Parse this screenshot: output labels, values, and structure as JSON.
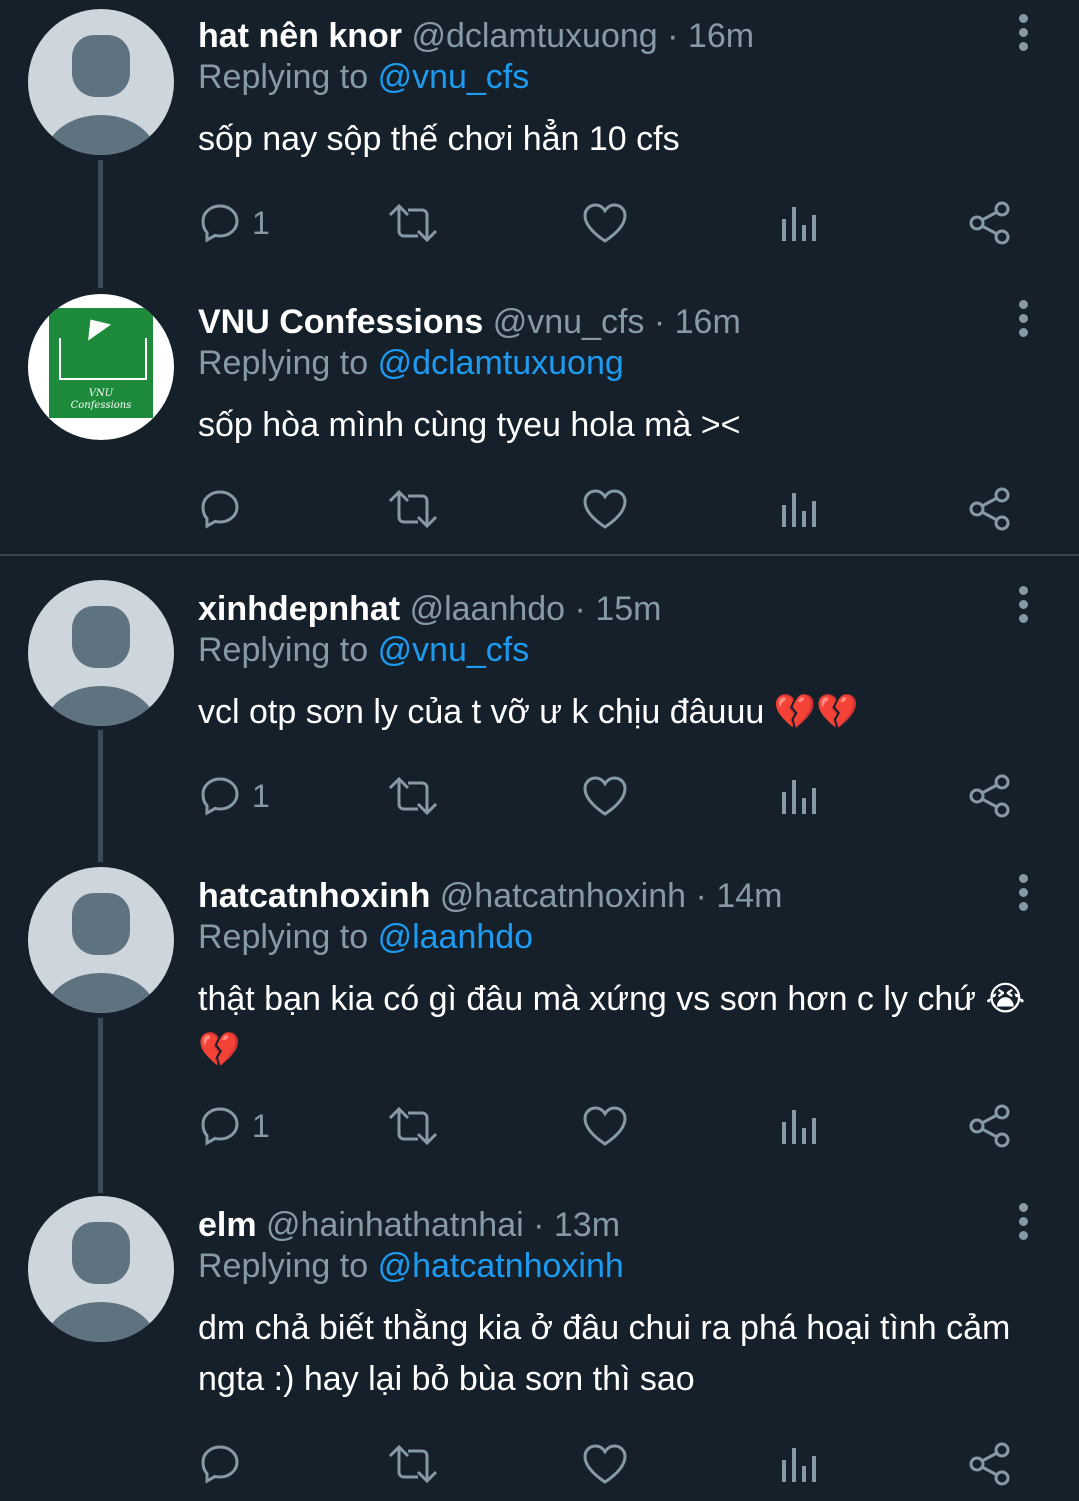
{
  "tweets": [
    {
      "name": "hat nên knor",
      "handle": "@dclamtuxuong",
      "time": "· 16m",
      "replying_label": "Replying to",
      "replying_to": "@vnu_cfs",
      "text": "sốp nay sộp thế chơi hẳn 10 cfs",
      "reply_count": "1"
    },
    {
      "name": "VNU Confessions",
      "handle": "@vnu_cfs",
      "time": "· 16m",
      "replying_label": "Replying to",
      "replying_to": "@dclamtuxuong",
      "text": "sốp hòa mình cùng tyeu hola mà ><",
      "reply_count": "",
      "avatar_text": "VNU",
      "avatar_subtext": "Confessions"
    },
    {
      "name": "xinhdepnhat",
      "handle": "@laanhdo",
      "time": "· 15m",
      "replying_label": "Replying to",
      "replying_to": "@vnu_cfs",
      "text": "vcl otp sơn ly của t vỡ ư k chịu đâuuu 💔💔",
      "reply_count": "1"
    },
    {
      "name": "hatcatnhoxinh",
      "handle": "@hatcatnhoxinh",
      "time": "· 14m",
      "replying_label": "Replying to",
      "replying_to": "@laanhdo",
      "text": "thật bạn kia có gì đâu mà xứng vs sơn hơn c ly chứ 😭💔",
      "reply_count": "1"
    },
    {
      "name": "elm",
      "handle": "@hainhathatnhai",
      "time": "· 13m",
      "replying_label": "Replying to",
      "replying_to": "@hatcatnhoxinh",
      "text": "dm chả biết thằng kia ở đâu chui ra phá hoại tình cảm ngta :) hay lại bỏ bùa sơn thì sao",
      "reply_count": ""
    }
  ],
  "colors": {
    "background": "#15202b",
    "secondary_text": "#8899a6",
    "link": "#1d9bf0"
  },
  "icons": [
    "reply-icon",
    "retweet-icon",
    "like-icon",
    "analytics-icon",
    "share-icon",
    "more-icon"
  ]
}
